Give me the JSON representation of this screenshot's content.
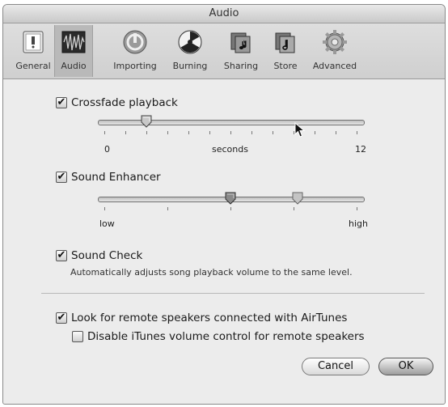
{
  "window": {
    "title": "Audio"
  },
  "toolbar": {
    "items": [
      {
        "label": "General",
        "icon": "switch-icon"
      },
      {
        "label": "Audio",
        "icon": "waveform-icon",
        "selected": true
      },
      {
        "label": "Importing",
        "icon": "importing-icon"
      },
      {
        "label": "Burning",
        "icon": "radiation-icon"
      },
      {
        "label": "Sharing",
        "icon": "music-folders-icon"
      },
      {
        "label": "Store",
        "icon": "store-folder-icon"
      },
      {
        "label": "Advanced",
        "icon": "gear-icon"
      }
    ]
  },
  "crossfade": {
    "checked": true,
    "label": "Crossfade playback",
    "min_label": "0",
    "mid_label": "seconds",
    "max_label": "12",
    "value_seconds": 2
  },
  "sound_enhancer": {
    "checked": true,
    "label": "Sound Enhancer",
    "min_label": "low",
    "max_label": "high",
    "value_fraction": 0.5
  },
  "sound_check": {
    "checked": true,
    "label": "Sound Check",
    "description": "Automatically adjusts song playback volume to the same level."
  },
  "airtunes": {
    "checked": true,
    "label": "Look for remote speakers connected with AirTunes"
  },
  "disable_volume": {
    "checked": false,
    "label": "Disable iTunes volume control for remote speakers"
  },
  "buttons": {
    "cancel": "Cancel",
    "ok": "OK"
  },
  "check_glyph": "✔"
}
